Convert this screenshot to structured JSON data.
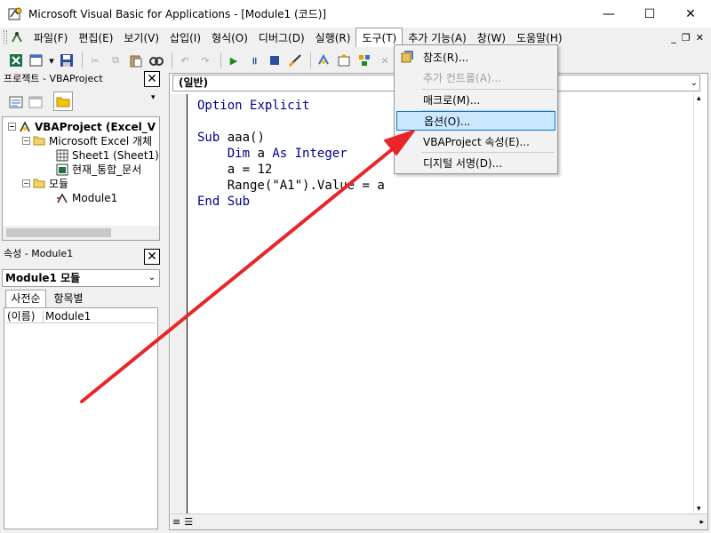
{
  "window": {
    "title": "Microsoft Visual Basic for Applications - [Module1 (코드)]",
    "minimize": "—",
    "maximize": "☐",
    "close": "✕"
  },
  "menubar": {
    "items": [
      "파일(F)",
      "편집(E)",
      "보기(V)",
      "삽입(I)",
      "형식(O)",
      "디버그(D)",
      "실행(R)",
      "도구(T)",
      "추가 기능(A)",
      "창(W)",
      "도움말(H)"
    ],
    "open_item": "도구(T)"
  },
  "tools_menu": {
    "items": [
      {
        "label": "참조(R)...",
        "state": "normal",
        "icon": "references-icon"
      },
      {
        "label": "추가 컨트롤(A)...",
        "state": "disabled",
        "icon": ""
      },
      {
        "label": "매크로(M)...",
        "state": "normal",
        "icon": ""
      },
      {
        "label": "옵션(O)...",
        "state": "highlighted",
        "icon": ""
      },
      {
        "label": "VBAProject 속성(E)...",
        "state": "normal",
        "icon": ""
      },
      {
        "label": "디지털 서명(D)...",
        "state": "normal",
        "icon": ""
      }
    ]
  },
  "project_pane": {
    "title": "프로젝트 - VBAProject",
    "close": "✕",
    "tree": [
      {
        "label": "VBAProject (Excel_V",
        "bold": true,
        "expander": "−",
        "icon": "vbaproject-icon"
      },
      {
        "label": "Microsoft Excel 개체",
        "bold": false,
        "expander": "−",
        "icon": "folder-icon"
      },
      {
        "label": "Sheet1 (Sheet1)",
        "bold": false,
        "expander": "",
        "icon": "sheet-icon"
      },
      {
        "label": "현재_통합_문서",
        "bold": false,
        "expander": "",
        "icon": "workbook-icon"
      },
      {
        "label": "모듈",
        "bold": false,
        "expander": "−",
        "icon": "folder-icon"
      },
      {
        "label": "Module1",
        "bold": false,
        "expander": "",
        "icon": "module-icon"
      }
    ]
  },
  "properties_pane": {
    "title": "속성 - Module1",
    "close": "✕",
    "object_combo": "Module1 모듈",
    "tabs": [
      "사전순",
      "항목별"
    ],
    "rows": [
      {
        "name": "(이름)",
        "value": "Module1"
      }
    ]
  },
  "code_window": {
    "object_combo": "(일반)",
    "lines": [
      "Option Explicit",
      "",
      "Sub aaa()",
      "    Dim a As Integer",
      "    a = 12",
      "    Range(\"A1\").Value = a",
      "End Sub"
    ],
    "keywords": [
      "Option",
      "Explicit",
      "Sub",
      "Dim",
      "As",
      "Integer",
      "End"
    ]
  },
  "colors": {
    "arrow": "#e8262a",
    "highlight_bg": "#cce8ff",
    "highlight_border": "#0078d7",
    "keyword": "#00008b"
  }
}
